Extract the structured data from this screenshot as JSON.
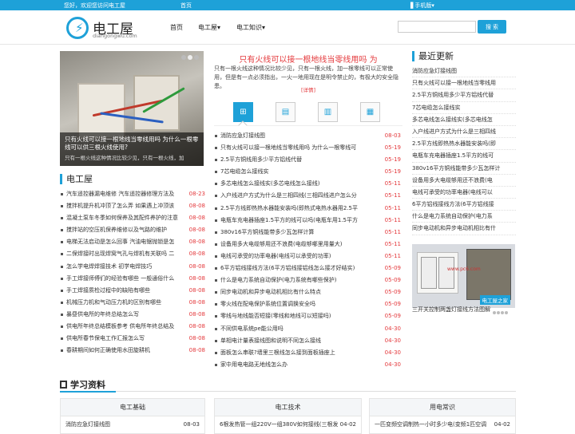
{
  "topbar": {
    "welcome": "您好，欢迎您访问电工屋",
    "home": "首页",
    "mobile": "▋手机版▾"
  },
  "header": {
    "logo_name": "电工屋",
    "logo_domain": "diangongwu.com",
    "bolt": "⚡"
  },
  "nav": {
    "home": "首页",
    "diangongwu": "电工屋▾",
    "knowledge": "电工知识▾"
  },
  "search": {
    "placeholder": "",
    "button": "搜 索"
  },
  "slider": {
    "title": "只有火线可以接一根地线当零线用吗 为什么一根零线可以供三根火线使用?",
    "subtitle": "只有一根火线这种情况比较少见，只有一根火线，加"
  },
  "section_diangong": {
    "title": "电工屋",
    "items": [
      {
        "t": "汽车遥控器漏电维修 汽车遥控器修理方法及",
        "d": "08-23"
      },
      {
        "t": "搅拌机提升机冲顶了怎么弄 如果遇上冲顶该",
        "d": "08-08"
      },
      {
        "t": "混凝土泵车冬季如何保养及其配件养护的注意",
        "d": "08-08"
      },
      {
        "t": "搅拌站的空压机保养维修以及气路的维护",
        "d": "08-08"
      },
      {
        "t": "电梯无法启动是怎么回事 汽油电锯抛锁是怎",
        "d": "08-08"
      },
      {
        "t": "二保焊接时出现焊窝气孔与焊机有关联吗 二",
        "d": "08-08"
      },
      {
        "t": "怎么学电焊焊接技术 初学电焊技巧",
        "d": "08-08"
      },
      {
        "t": "手工焊接师傅们的经验有哪些 一般通俗什么",
        "d": "08-08"
      },
      {
        "t": "手工焊接质检过程中的缺陷有哪些",
        "d": "08-08"
      },
      {
        "t": "机械压力机和气动压力机的区别有哪些",
        "d": "08-08"
      },
      {
        "t": "暴昼供电所的年终总结怎么写",
        "d": "08-08"
      },
      {
        "t": "供电所年终总结模板参考 供电所年终总结及",
        "d": "08-08"
      },
      {
        "t": "供电所春节保电工作汇报怎么写",
        "d": "08-08"
      },
      {
        "t": "春耕期间如何正确使用水田旋耕机",
        "d": "08-08"
      }
    ]
  },
  "feature": {
    "title": "只有火线可以接一根地线当零线用吗 为",
    "desc": "只有一根火线这种情况比较少见，只有一根火线，加一根零线可以正常使用，但是有一点必须指出，一火一地用现在是明令禁止的，有极大的安全隐患。",
    "detail": "[详情]"
  },
  "feature_list": [
    {
      "t": "消防应急灯接线图",
      "d": "08-03"
    },
    {
      "t": "只有火线可以接一根地线当零线用吗 为什么一根零线可",
      "d": "05-19"
    },
    {
      "t": "2.5平方铜线用多少平方铝线代替",
      "d": "05-19"
    },
    {
      "t": "7芯电缆怎么接线实",
      "d": "05-19"
    },
    {
      "t": "多芯电线怎么接线实(多芯电线怎么接线)",
      "d": "05-11"
    },
    {
      "t": "入户线进户方式为什么是三相四线(三相四线进户怎么分",
      "d": "05-11"
    },
    {
      "t": "2.5平方线即热热水器能安装吗(即热式电热水器用2.5平",
      "d": "05-11"
    },
    {
      "t": "电瓶车充电器插座1.5平方的线可以吗(电瓶车用1.5平方",
      "d": "05-11"
    },
    {
      "t": "380v16平方铜线能带多少瓦怎样计算",
      "d": "05-11"
    },
    {
      "t": "设备用多大电缆够用还不浪费(电缆够哪里用量大)",
      "d": "05-11"
    },
    {
      "t": "电线可承受的功率电器(电线可以承受的功率)",
      "d": "05-11"
    },
    {
      "t": "6平方铝线接线方法(6平方铝线接铝线怎么接才好结实)",
      "d": "05-09"
    },
    {
      "t": "什么是电力系统自动保护(电力系统有哪些保护)",
      "d": "05-09"
    },
    {
      "t": "同步电动机和异步电动机相比有什么特点",
      "d": "05-09"
    },
    {
      "t": "零火线在配电保护系统位置调换安全吗",
      "d": "05-09"
    },
    {
      "t": "零线与地线能否短接(零线和地线可以短接吗)",
      "d": "05-09"
    },
    {
      "t": "不同供电系统pe能公用吗",
      "d": "04-30"
    },
    {
      "t": "单相电计量表接线图和说明不同怎么接线",
      "d": "04-30"
    },
    {
      "t": "面板怎么串联?墙里三根线怎么接到面板插座上",
      "d": "04-30"
    },
    {
      "t": "家中用电电路无地线怎么办",
      "d": "04-30"
    }
  ],
  "latest": {
    "title": "最近更新",
    "items": [
      "消防应急灯接线图",
      "只有火线可以接一根地线当零线用",
      "2.5平方铜线用多少平方铝线代替",
      "7芯电缆怎么接线实",
      "多芯电线怎么接线实(多芯电线怎",
      "入户线进户方式为什么是三相四线",
      "2.5平方线即热热水器能安装吗(即",
      "电瓶车充电器插座1.5平方的线可",
      "380v16平方铜线能带多少瓦怎样计",
      "设备用多大电缆够用还不浪费(电",
      "电线可承受的功率电器(电线可以",
      "6平方铝线接线方法(6平方铝线接",
      "什么是电力系统自动保护(电力系",
      "同步电动机和异步电动机相比有什"
    ],
    "image_caption": "三开关控制两盏灯接线方法图解",
    "image_tag": "电工屋之家",
    "image_url": "www.pc6.com"
  },
  "study": {
    "title": "学习资料",
    "columns": [
      {
        "head": "电工基础",
        "row": "消防应急灯接线图",
        "date": "08-03"
      },
      {
        "head": "电工技术",
        "row": "6根发热管一组220V一组380V如何接线(三根发",
        "date": "04-02"
      },
      {
        "head": "用电常识",
        "row": "一匹变频空调制热一小时多少电(变频1匹空调",
        "date": "04-02"
      }
    ]
  },
  "colors": {
    "accent": "#1ea1d8",
    "date_red": "#e4393c"
  }
}
